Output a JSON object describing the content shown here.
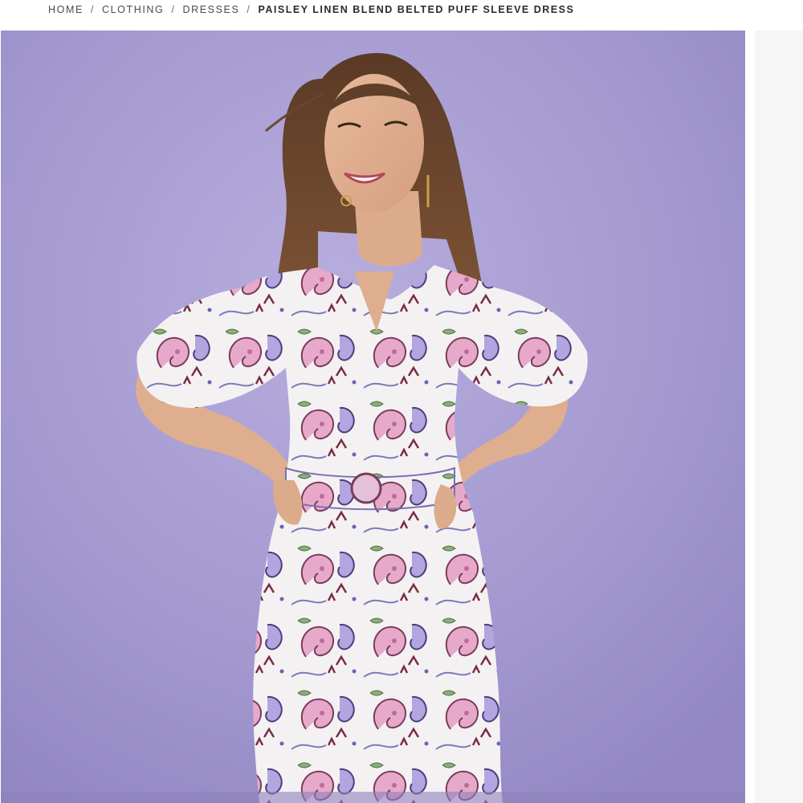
{
  "breadcrumb": {
    "items": [
      {
        "label": "HOME"
      },
      {
        "label": "CLOTHING"
      },
      {
        "label": "DRESSES"
      }
    ],
    "current": "PAISLEY LINEN BLEND BELTED PUFF SLEEVE DRESS",
    "separator": "/"
  },
  "product_image": {
    "background_color": "#a99fd4"
  }
}
